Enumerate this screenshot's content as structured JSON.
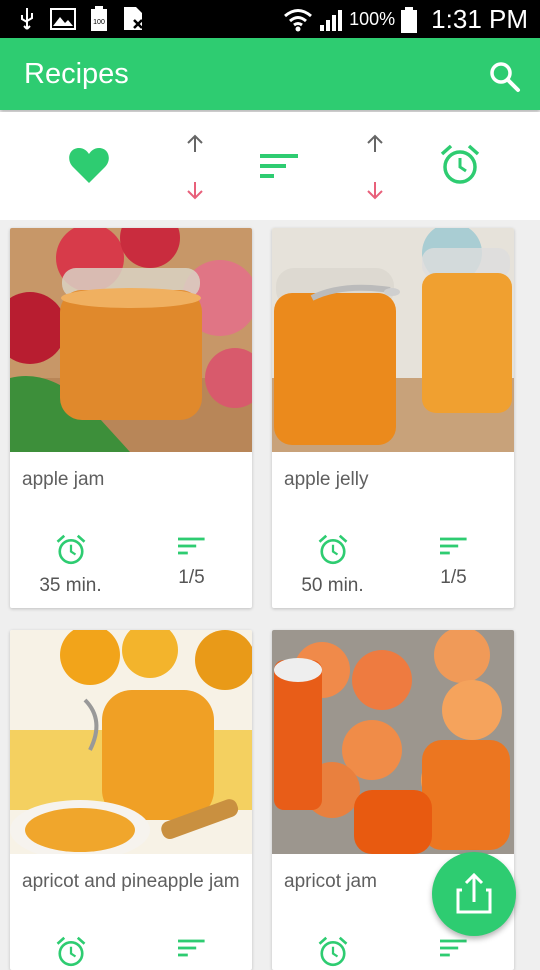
{
  "status_bar": {
    "battery": "100%",
    "time": "1:31 PM",
    "battery_small": "100"
  },
  "app_bar": {
    "title": "Recipes"
  },
  "colors": {
    "accent": "#2ecc71",
    "down_arrow": "#e8607a",
    "up_arrow": "#666666"
  },
  "cards": [
    {
      "title": "apple jam",
      "time": "35 min.",
      "difficulty": "1/5"
    },
    {
      "title": "apple jelly",
      "time": "50 min.",
      "difficulty": "1/5"
    },
    {
      "title": "apricot and pineapple jam",
      "time": "",
      "difficulty": ""
    },
    {
      "title": "apricot jam",
      "time": "",
      "difficulty": ""
    }
  ]
}
